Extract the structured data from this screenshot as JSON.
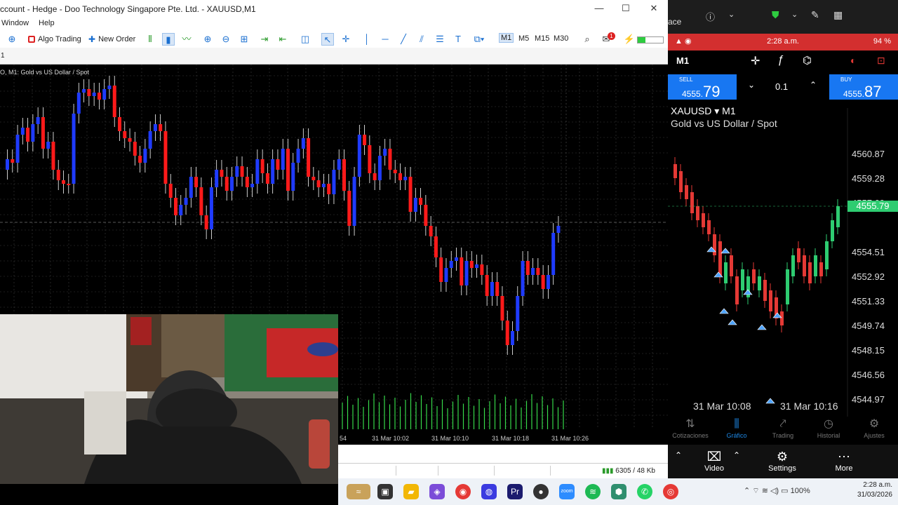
{
  "window": {
    "title": "ccount - Hedge - Doo Technology Singapore Pte. Ltd. - XAUUSD,M1",
    "minimize": "—",
    "maximize": "☐",
    "close": "✕"
  },
  "menu": [
    "Window",
    "Help"
  ],
  "toolbar": {
    "algo_trading": "Algo Trading",
    "new_order": "New Order",
    "timeframes": [
      "M1",
      "M5",
      "M15",
      "M30"
    ],
    "active_timeframe": "M1",
    "notifications_count": "1"
  },
  "subbar": {
    "tab_label": "1"
  },
  "chart": {
    "label": "O, M1:  Gold vs US Dollar / Spot",
    "time_labels": [
      "54",
      "31 Mar 10:02",
      "31 Mar 10:10",
      "31 Mar 10:18",
      "31 Mar 10:26"
    ]
  },
  "status": {
    "traffic": "6305 / 48 Kb"
  },
  "phone_top": {
    "label": "ace"
  },
  "phone": {
    "time": "2:28 a.m.",
    "battery": "94 %",
    "timeframe": "M1",
    "sell_label": "SELL",
    "sell_price_main": "4555.",
    "sell_price_big": "79",
    "volume": "0.1",
    "buy_label": "BUY",
    "buy_price_main": "4555.",
    "buy_price_big": "87",
    "symbol": "XAUUSD ▾ M1",
    "description": "Gold vs US Dollar / Spot",
    "price_levels": [
      "4560.87",
      "4559.28",
      "4557.69",
      "4554.51",
      "4552.92",
      "4551.33",
      "4549.74",
      "4548.15",
      "4546.56",
      "4544.97"
    ],
    "current_price": "4555.79",
    "time_labels": [
      "31 Mar 10:08",
      "31 Mar 10:16"
    ],
    "nav": [
      "Cotizaciones",
      "Gráfico",
      "Trading",
      "Historial",
      "Ajustes"
    ],
    "active_nav": "Gráfico",
    "bottom": [
      "Video",
      "Settings",
      "More"
    ]
  },
  "taskbar": {
    "battery": "100%",
    "time": "2:28 a.m.",
    "date": "31/03/2026"
  },
  "colors": {
    "bull": "#1f3bff",
    "bear": "#ff1a1a",
    "grid": "#3a3a3a",
    "phone_bull": "#2ecc71",
    "phone_bear": "#e53935",
    "accent": "#1877f2"
  }
}
